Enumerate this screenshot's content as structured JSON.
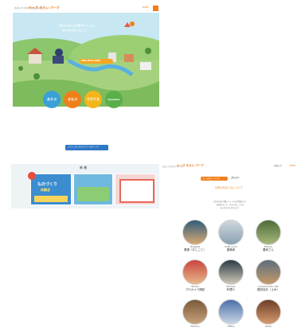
{
  "top_page": {
    "logo_small": "おおいたのまちからつくる",
    "logo": "キッズ みらい パーク",
    "menu_label": "MENU",
    "hero_caption_1": "あなたもぼくらの街でいっしょに",
    "hero_caption_2": "みらいのまちへ行こう！",
    "banner_sign": "KIDS MIRAI PARK",
    "circle_buttons": [
      {
        "label": "あそぶ",
        "color": "#3aa0d8"
      },
      {
        "label": "まなぶ",
        "color": "#ef7f1a"
      },
      {
        "label": "そだてる",
        "color": "#f3b51b"
      },
      {
        "label": "Question",
        "color": "#5aaf4b"
      }
    ],
    "cta_label": "くわしくはこちらのバナーをクリック"
  },
  "banners_section": {
    "heading": "新 着",
    "banner_1_title": "ものづくり",
    "banner_1_sub": "体験会"
  },
  "second_page": {
    "logo_small": "おおいたのまちからつくる",
    "logo": "キッズ みらい パーク",
    "nav_links": [
      "お知らせ",
      "MENU"
    ],
    "tag_1": "キッズ未来パークとは",
    "tag_2": "活動の紹介",
    "title": "仕事のみなさんについて",
    "intro_1": "大分のまちで働くたくさんの仕事の人に",
    "intro_2": "お話をきいて、みらいのしごとを",
    "intro_3": "みんなでかんがえよう！"
  },
  "people": [
    {
      "caption": "Hospital",
      "name": "看護（おしごと）",
      "colors": [
        "#2f5d7c",
        "#d7a873"
      ]
    },
    {
      "caption": "Craft room",
      "name": "建築家",
      "colors": [
        "#cfd8de",
        "#8aa2b1"
      ]
    },
    {
      "caption": "Farmer",
      "name": "農家さん",
      "colors": [
        "#4d6b3a",
        "#a8b87a"
      ]
    },
    {
      "caption": "Studio",
      "name": "プロカメラ撮影",
      "colors": [
        "#c9443f",
        "#e8b98b"
      ]
    },
    {
      "caption": "Kitchen",
      "name": "料理人",
      "colors": [
        "#2a3b45",
        "#d0c8b8"
      ]
    },
    {
      "caption": "Construction site",
      "name": "建設会社（土木）",
      "colors": [
        "#5b6e7d",
        "#c59a68"
      ]
    },
    {
      "caption": "Factory",
      "name": "",
      "colors": [
        "#7a5a3b",
        "#c7a27a"
      ]
    },
    {
      "caption": "Office",
      "name": "",
      "colors": [
        "#4b6fa8",
        "#c9d7e6"
      ]
    },
    {
      "caption": "Shop",
      "name": "",
      "colors": [
        "#6e3e2a",
        "#d69a6c"
      ]
    }
  ]
}
